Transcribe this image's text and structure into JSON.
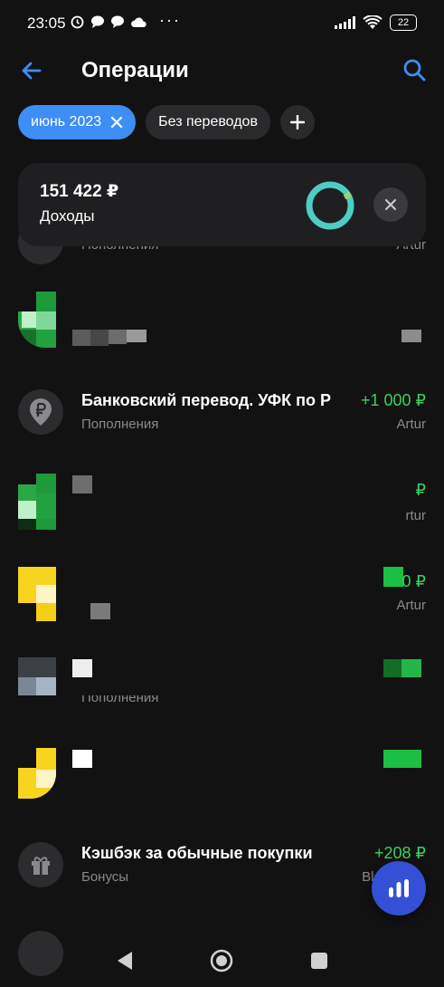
{
  "status_bar": {
    "time": "23:05",
    "battery": "22"
  },
  "header": {
    "title": "Операции"
  },
  "filters": {
    "period": "июнь 2023",
    "transfers": "Без переводов"
  },
  "summary": {
    "amount": "151 422 ₽",
    "label": "Доходы"
  },
  "transactions": [
    {
      "title": "",
      "category": "Пополнения",
      "amount": "",
      "account": "Artur"
    },
    {
      "title": "",
      "category": "",
      "amount": "",
      "account": ""
    },
    {
      "title": "Банковский перевод. УФК по Р",
      "category": "Пополнения",
      "amount": "+1 000 ₽",
      "account": "Artur"
    },
    {
      "title": "",
      "category": "",
      "amount": "₽",
      "account": "rtur"
    },
    {
      "title": "",
      "category": "",
      "amount": "0 ₽",
      "account": "Artur"
    },
    {
      "title": "",
      "category": "Пополнения",
      "amount": "",
      "account": ""
    },
    {
      "title": "",
      "category": "",
      "amount": "",
      "account": ""
    },
    {
      "title": "Кэшбэк за обычные покупки",
      "category": "Бонусы",
      "amount": "+208 ₽",
      "account": "Black P"
    }
  ],
  "colors": {
    "accent": "#3d8ef5",
    "income": "#3ad15d",
    "fab": "#3450d6",
    "donut": "#4ecdc4"
  }
}
